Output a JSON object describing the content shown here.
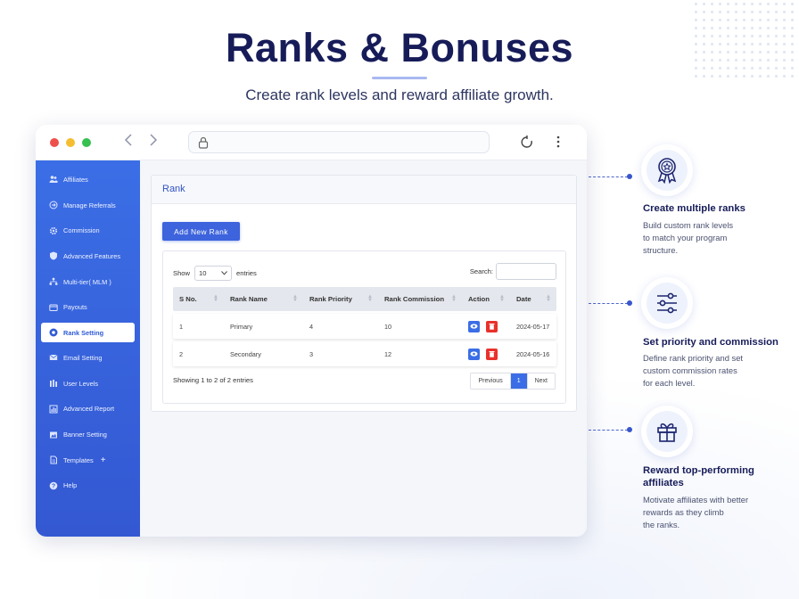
{
  "hero": {
    "title": "Ranks & Bonuses",
    "subtitle": "Create rank levels and reward affiliate growth."
  },
  "colors": {
    "accent": "#3b6ee6",
    "title": "#171c59",
    "delete": "#e9312c"
  },
  "sidebar": {
    "items": [
      {
        "label": "Affiliates",
        "icon": "users-icon"
      },
      {
        "label": "Manage Referrals",
        "icon": "referral-icon"
      },
      {
        "label": "Commission",
        "icon": "gear-icon"
      },
      {
        "label": "Advanced Features",
        "icon": "shield-icon"
      },
      {
        "label": "Multi-tier( MLM )",
        "icon": "network-icon"
      },
      {
        "label": "Payouts",
        "icon": "wallet-icon"
      },
      {
        "label": "Rank Setting",
        "icon": "rank-icon",
        "active": true
      },
      {
        "label": "Email Setting",
        "icon": "mail-icon"
      },
      {
        "label": "User Levels",
        "icon": "levels-icon"
      },
      {
        "label": "Advanced Report",
        "icon": "report-icon"
      },
      {
        "label": "Banner Setting",
        "icon": "banner-icon"
      },
      {
        "label": "Templates",
        "icon": "template-icon",
        "suffix": "+"
      },
      {
        "label": "Help",
        "icon": "help-icon"
      }
    ]
  },
  "page": {
    "title": "Rank",
    "add_button": "Add New Rank",
    "show_label": "Show",
    "entries_value": "10",
    "entries_label": "entries",
    "search_label": "Search:",
    "search_value": "",
    "showing_text": "Showing 1 to 2 of 2 entries",
    "pager": {
      "previous": "Previous",
      "current": "1",
      "next": "Next"
    }
  },
  "table": {
    "headers": [
      "S No.",
      "Rank Name",
      "Rank Priority",
      "Rank Commission",
      "Action",
      "Date"
    ],
    "rows": [
      {
        "sno": "1",
        "name": "Primary",
        "priority": "4",
        "commission": "10",
        "date": "2024-05-17"
      },
      {
        "sno": "2",
        "name": "Secondary",
        "priority": "3",
        "commission": "12",
        "date": "2024-05-16"
      }
    ]
  },
  "features": [
    {
      "icon": "badge-star-icon",
      "title": "Create multiple ranks",
      "desc_lines": [
        "Build custom rank levels",
        "to match your program",
        "structure."
      ]
    },
    {
      "icon": "sliders-icon",
      "title": "Set priority and commission",
      "desc_lines": [
        "Define rank priority and set",
        "custom commission rates",
        "for each level."
      ]
    },
    {
      "icon": "gift-icon",
      "title_lines": [
        "Reward top-performing",
        "affiliates"
      ],
      "desc_lines": [
        "Motivate affiliates with better",
        "rewards as they climb",
        "the ranks."
      ]
    }
  ]
}
